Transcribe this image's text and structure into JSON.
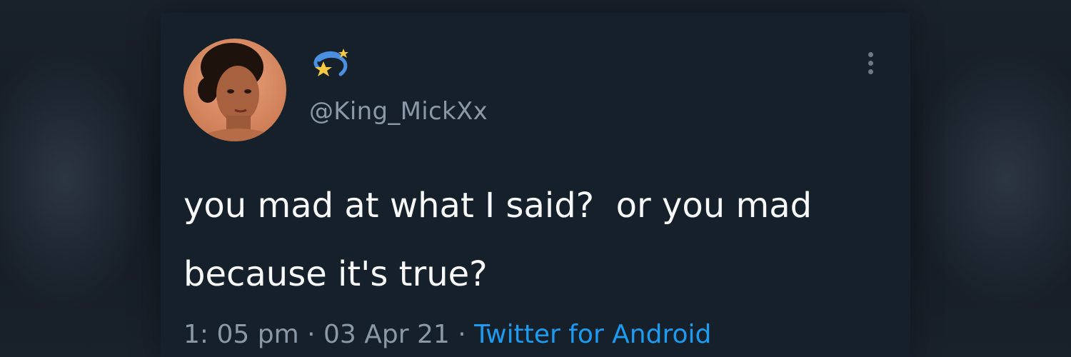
{
  "tweet": {
    "handle": "@King_MickXx",
    "display_name_icon": "dizzy-star-emoji-icon",
    "text": "you mad at what I said?  or you mad because it's true?",
    "time": "1: 05 pm",
    "separator": " · ",
    "date": "03 Apr 21",
    "separator2": "· ",
    "source": "Twitter for Android"
  },
  "colors": {
    "background": "#15202b",
    "text": "#f7f9f9",
    "secondary": "#8b98a5",
    "link": "#1d9bf0"
  }
}
